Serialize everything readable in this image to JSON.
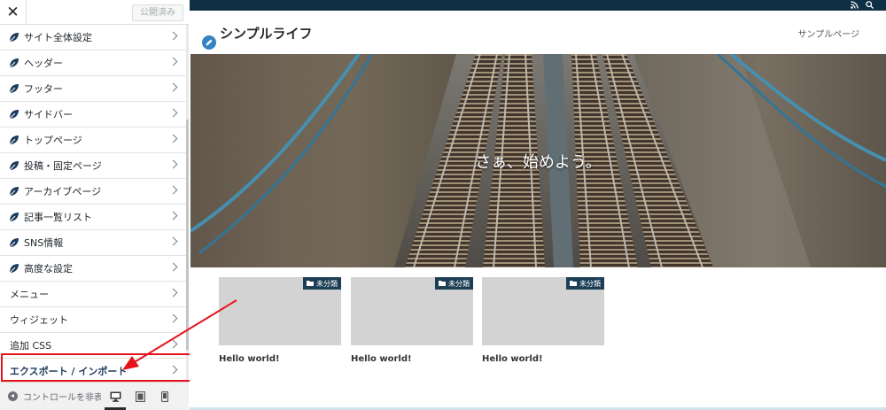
{
  "sidebar": {
    "close_label": "✕",
    "publish_label": "公開済み",
    "items": [
      {
        "label": "サイト全体設定",
        "leaf": true
      },
      {
        "label": "ヘッダー",
        "leaf": true
      },
      {
        "label": "フッター",
        "leaf": true
      },
      {
        "label": "サイドバー",
        "leaf": true
      },
      {
        "label": "トップページ",
        "leaf": true
      },
      {
        "label": "投稿・固定ページ",
        "leaf": true
      },
      {
        "label": "アーカイブページ",
        "leaf": true
      },
      {
        "label": "記事一覧リスト",
        "leaf": true
      },
      {
        "label": "SNS情報",
        "leaf": true
      },
      {
        "label": "高度な設定",
        "leaf": true
      },
      {
        "label": "メニュー",
        "leaf": false
      },
      {
        "label": "ウィジェット",
        "leaf": false
      },
      {
        "label": "追加 CSS",
        "leaf": false
      },
      {
        "label": "エクスポート / インポート",
        "leaf": false
      }
    ],
    "footer": {
      "hide_controls_label": "コントロールを非表示"
    }
  },
  "preview": {
    "site_title": "シンプルライフ",
    "nav_link": "サンプルページ",
    "hero_caption": "さぁ、始めよう。",
    "posts": [
      {
        "category": "未分類",
        "title": "Hello world!"
      },
      {
        "category": "未分類",
        "title": "Hello world!"
      },
      {
        "category": "未分類",
        "title": "Hello world!"
      }
    ]
  },
  "colors": {
    "topbar": "#0f2f45",
    "accent": "#3582c4",
    "annotation": "#e5141c",
    "category_badge": "#1c3f55"
  }
}
